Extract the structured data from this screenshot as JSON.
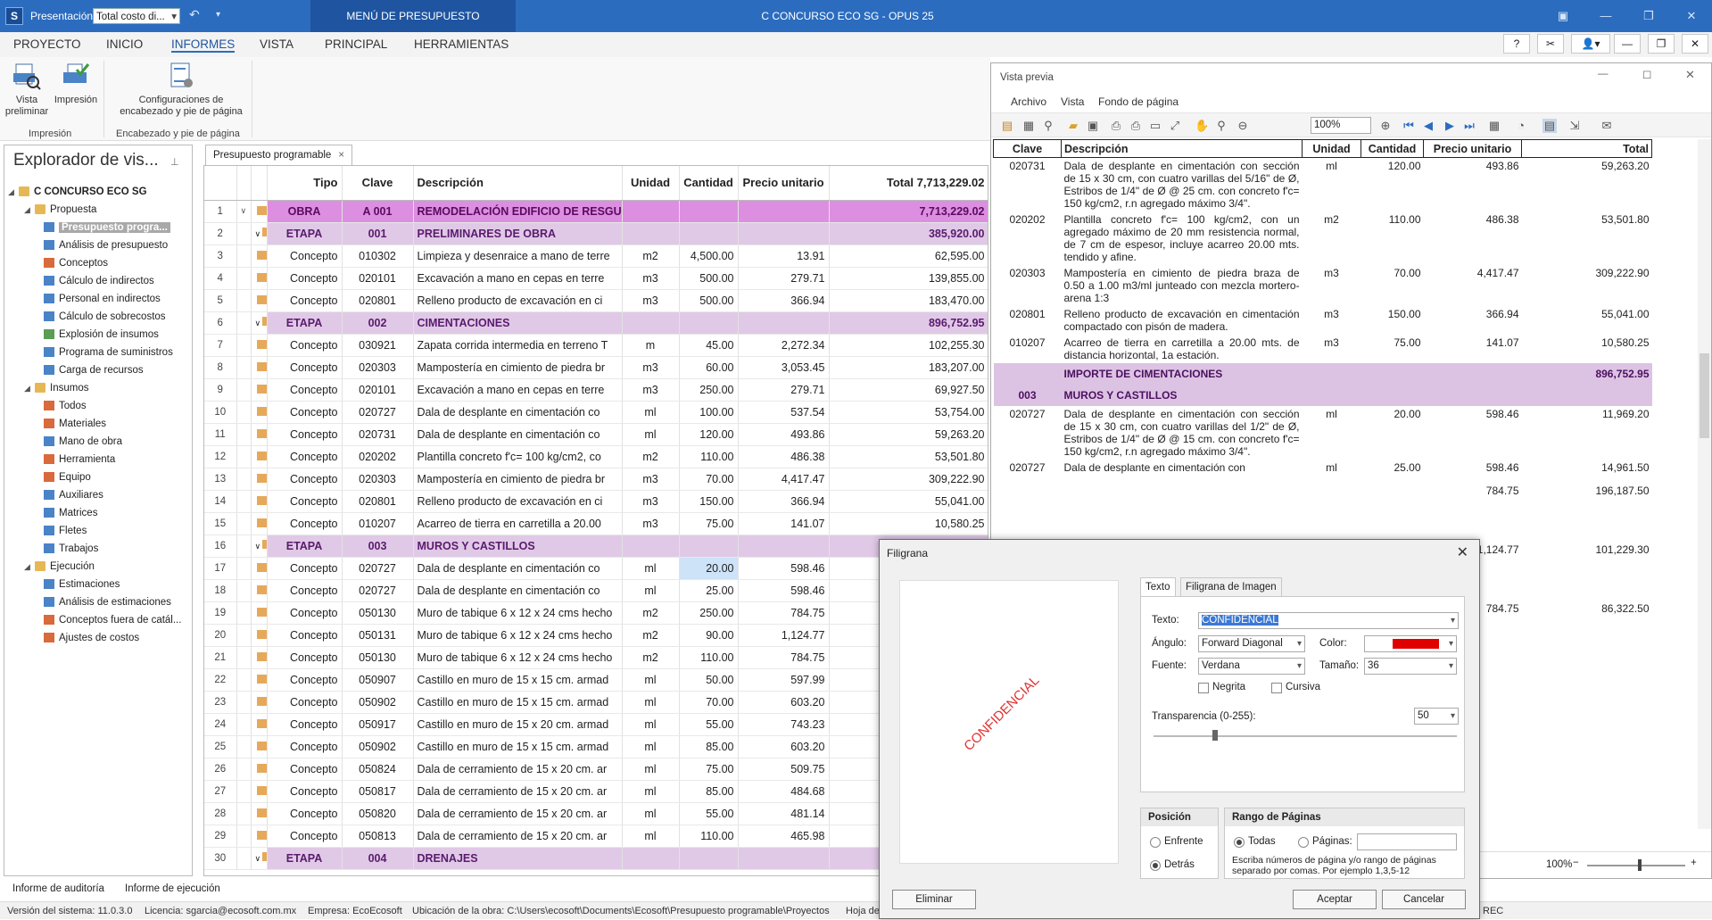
{
  "titlebar": {
    "app_icon": "S",
    "presentation_label": "Presentación:",
    "presentation_value": "Total costo di...",
    "menu_tab": "MENÚ DE PRESUPUESTO",
    "title": "C CONCURSO ECO SG - OPUS 25"
  },
  "menu": {
    "items": [
      "PROYECTO",
      "INICIO",
      "INFORMES",
      "VISTA",
      "PRINCIPAL",
      "HERRAMIENTAS"
    ],
    "active": "INFORMES",
    "help": "?"
  },
  "ribbon": {
    "vista_previa": "Vista\npreliminar",
    "impresion": "Impresión",
    "config": "Configuraciones de\nencabezado y pie de página",
    "group_impresion": "Impresión",
    "group_encabezado": "Encabezado y pie de página"
  },
  "explorer": {
    "title": "Explorador de vis...",
    "root": "C CONCURSO ECO SG",
    "propuesta": "Propuesta",
    "propuesta_items": [
      "Presupuesto progra...",
      "Análisis de presupuesto",
      "Conceptos",
      "Cálculo de indirectos",
      "Personal en indirectos",
      "Cálculo de sobrecostos",
      "Explosión de insumos",
      "Programa de suministros",
      "Carga de recursos"
    ],
    "insumos": "Insumos",
    "insumos_items": [
      "Todos",
      "Materiales",
      "Mano de obra",
      "Herramienta",
      "Equipo",
      "Auxiliares",
      "Matrices",
      "Fletes",
      "Trabajos"
    ],
    "ejecucion": "Ejecución",
    "ejecucion_items": [
      "Estimaciones",
      "Análisis de estimaciones",
      "Conceptos fuera de catál...",
      "Ajustes de costos"
    ]
  },
  "grid": {
    "tab": "Presupuesto programable",
    "headers": {
      "tipo": "Tipo",
      "clave": "Clave",
      "desc": "Descripción",
      "unidad": "Unidad",
      "cantidad": "Cantidad",
      "pu": "Precio unitario",
      "total": "Total 7,713,229.02"
    },
    "rows": [
      [
        "1",
        "OBRA",
        "A 001",
        "REMODELACIÓN EDIFICIO DE RESGUARD",
        "",
        "",
        "",
        "7,713,229.02",
        "obra"
      ],
      [
        "2",
        "ETAPA",
        "001",
        "PRELIMINARES DE OBRA",
        "",
        "",
        "",
        "385,920.00",
        "etapa"
      ],
      [
        "3",
        "Concepto",
        "010302",
        "Limpieza y desenraice a mano de terre",
        "m2",
        "4,500.00",
        "13.91",
        "62,595.00",
        "c"
      ],
      [
        "4",
        "Concepto",
        "020101",
        "Excavación a mano en cepas en terre",
        "m3",
        "500.00",
        "279.71",
        "139,855.00",
        "c"
      ],
      [
        "5",
        "Concepto",
        "020801",
        "Relleno producto de excavación en ci",
        "m3",
        "500.00",
        "366.94",
        "183,470.00",
        "c"
      ],
      [
        "6",
        "ETAPA",
        "002",
        "CIMENTACIONES",
        "",
        "",
        "",
        "896,752.95",
        "etapa"
      ],
      [
        "7",
        "Concepto",
        "030921",
        "Zapata corrida intermedia en terreno T",
        "m",
        "45.00",
        "2,272.34",
        "102,255.30",
        "c"
      ],
      [
        "8",
        "Concepto",
        "020303",
        "Mampostería en cimiento de piedra br",
        "m3",
        "60.00",
        "3,053.45",
        "183,207.00",
        "c"
      ],
      [
        "9",
        "Concepto",
        "020101",
        "Excavación a mano en cepas en terre",
        "m3",
        "250.00",
        "279.71",
        "69,927.50",
        "c"
      ],
      [
        "10",
        "Concepto",
        "020727",
        "Dala de desplante en cimentación co",
        "ml",
        "100.00",
        "537.54",
        "53,754.00",
        "c"
      ],
      [
        "11",
        "Concepto",
        "020731",
        "Dala de desplante en cimentación co",
        "ml",
        "120.00",
        "493.86",
        "59,263.20",
        "c"
      ],
      [
        "12",
        "Concepto",
        "020202",
        "Plantilla concreto f'c= 100 kg/cm2, co",
        "m2",
        "110.00",
        "486.38",
        "53,501.80",
        "c"
      ],
      [
        "13",
        "Concepto",
        "020303",
        "Mampostería en cimiento de piedra br",
        "m3",
        "70.00",
        "4,417.47",
        "309,222.90",
        "c"
      ],
      [
        "14",
        "Concepto",
        "020801",
        "Relleno producto de excavación en ci",
        "m3",
        "150.00",
        "366.94",
        "55,041.00",
        "c"
      ],
      [
        "15",
        "Concepto",
        "010207",
        "Acarreo de tierra en carretilla a 20.00",
        "m3",
        "75.00",
        "141.07",
        "10,580.25",
        "c"
      ],
      [
        "16",
        "ETAPA",
        "003",
        "MUROS Y CASTILLOS",
        "",
        "",
        "",
        "",
        "etapa"
      ],
      [
        "17",
        "Concepto",
        "020727",
        "Dala de desplante en cimentación co",
        "ml",
        "20.00",
        "598.46",
        "",
        "c"
      ],
      [
        "18",
        "Concepto",
        "020727",
        "Dala de desplante en cimentación co",
        "ml",
        "25.00",
        "598.46",
        "",
        "c"
      ],
      [
        "19",
        "Concepto",
        "050130",
        "Muro de tabique 6 x 12 x 24 cms hecho",
        "m2",
        "250.00",
        "784.75",
        "",
        "c"
      ],
      [
        "20",
        "Concepto",
        "050131",
        "Muro de tabique 6 x 12 x 24 cms hecho",
        "m2",
        "90.00",
        "1,124.77",
        "",
        "c"
      ],
      [
        "21",
        "Concepto",
        "050130",
        "Muro de tabique 6 x 12 x 24 cms hecho",
        "m2",
        "110.00",
        "784.75",
        "",
        "c"
      ],
      [
        "22",
        "Concepto",
        "050907",
        "Castillo en muro de 15 x 15 cm. armad",
        "ml",
        "50.00",
        "597.99",
        "",
        "c"
      ],
      [
        "23",
        "Concepto",
        "050902",
        "Castillo en muro de 15 x 15 cm. armad",
        "ml",
        "70.00",
        "603.20",
        "",
        "c"
      ],
      [
        "24",
        "Concepto",
        "050917",
        "Castillo en muro de 15 x 20 cm. armad",
        "ml",
        "55.00",
        "743.23",
        "",
        "c"
      ],
      [
        "25",
        "Concepto",
        "050902",
        "Castillo en muro de 15 x 15 cm. armad",
        "ml",
        "85.00",
        "603.20",
        "",
        "c"
      ],
      [
        "26",
        "Concepto",
        "050824",
        "Dala de cerramiento de 15 x 20 cm. ar",
        "ml",
        "75.00",
        "509.75",
        "",
        "c"
      ],
      [
        "27",
        "Concepto",
        "050817",
        "Dala de cerramiento de 15 x 20 cm. ar",
        "ml",
        "85.00",
        "484.68",
        "",
        "c"
      ],
      [
        "28",
        "Concepto",
        "050820",
        "Dala de cerramiento de 15 x 20 cm. ar",
        "ml",
        "55.00",
        "481.14",
        "",
        "c"
      ],
      [
        "29",
        "Concepto",
        "050813",
        "Dala de cerramiento de 15 x 20 cm. ar",
        "ml",
        "110.00",
        "465.98",
        "",
        "c"
      ],
      [
        "30",
        "ETAPA",
        "004",
        "DRENAJES",
        "",
        "",
        "",
        "",
        "etapa"
      ]
    ]
  },
  "bottom_tabs": [
    "Informe de auditoría",
    "Informe de ejecución"
  ],
  "status": {
    "version": "Versión del sistema: 11.0.3.0",
    "license": "Licencia: sgarcia@ecosoft.com.mx",
    "company": "Empresa: EcoEcosoft",
    "location": "Ubicación de la obra: C:\\Users\\ecosoft\\Documents\\Ecosoft\\Presupuesto programable\\Proyectos",
    "sheet": "Hoja de",
    "rec": "REC"
  },
  "preview": {
    "title": "Vista previa",
    "menu": [
      "Archivo",
      "Vista",
      "Fondo de página"
    ],
    "zoom": "100%",
    "zoom_bottom": "100%",
    "headers": [
      "Clave",
      "Descripción",
      "Unidad",
      "Cantidad",
      "Precio unitario",
      "Total"
    ],
    "rows": [
      {
        "clave": "020731",
        "desc": "Dala de desplante en cimentación con sección de 15 x 30 cm, con cuatro varillas del 5/16\" de Ø, Estribos de 1/4\" de Ø @ 25 cm. con concreto f'c= 150 kg/cm2, r.n agregado máximo 3/4\".",
        "unidad": "ml",
        "cantidad": "120.00",
        "pu": "493.86",
        "total": "59,263.20"
      },
      {
        "clave": "020202",
        "desc": "Plantilla concreto f'c= 100 kg/cm2, con un agregado máximo de 20 mm resistencia normal, de 7 cm de espesor, incluye acarreo 20.00 mts. tendido y afine.",
        "unidad": "m2",
        "cantidad": "110.00",
        "pu": "486.38",
        "total": "53,501.80"
      },
      {
        "clave": "020303",
        "desc": "Mampostería en cimiento de piedra braza de 0.50 a 1.00 m3/ml junteado con mezcla mortero-arena 1:3",
        "unidad": "m3",
        "cantidad": "70.00",
        "pu": "4,417.47",
        "total": "309,222.90"
      },
      {
        "clave": "020801",
        "desc": "Relleno producto de excavación en cimentación compactado con pisón de madera.",
        "unidad": "m3",
        "cantidad": "150.00",
        "pu": "366.94",
        "total": "55,041.00"
      },
      {
        "clave": "010207",
        "desc": "Acarreo de tierra en carretilla a 20.00 mts. de distancia horizontal, 1a estación.",
        "unidad": "m3",
        "cantidad": "75.00",
        "pu": "141.07",
        "total": "10,580.25"
      }
    ],
    "importe_cim": "IMPORTE DE CIMENTACIONES",
    "importe_cim_total": "896,752.95",
    "etapa3_clave": "003",
    "etapa3_name": "MUROS Y CASTILLOS",
    "row_020727": {
      "clave": "020727",
      "desc": "Dala de desplante en cimentación con sección de 15 x 30 cm, con cuatro varillas del 1/2\" de Ø, Estribos de 1/4\" de Ø @ 15 cm. con concreto f'c= 150 kg/cm2, r.n agregado máximo 3/4\".",
      "unidad": "ml",
      "cantidad": "20.00",
      "pu": "598.46",
      "total": "11,969.20"
    },
    "row_020727b": {
      "clave": "020727",
      "desc": "Dala de desplante en cimentación con",
      "unidad": "ml",
      "cantidad": "25.00",
      "pu": "598.46",
      "total": "14,961.50"
    },
    "hidden_vals": [
      {
        "pu": "784.75",
        "total": "196,187.50"
      },
      {
        "pu": "1,124.77",
        "total": "101,229.30"
      },
      {
        "pu": "784.75",
        "total": "86,322.50"
      }
    ]
  },
  "dialog": {
    "title": "Filigrana",
    "watermark_preview": "CONFIDENCIAL",
    "tab_text": "Texto",
    "tab_image": "Filigrana de Imagen",
    "texto_label": "Texto:",
    "texto_value": "CONFIDENCIAL",
    "angulo_label": "Ángulo:",
    "angulo_value": "Forward Diagonal",
    "color_label": "Color:",
    "color_value": "#e00000",
    "fuente_label": "Fuente:",
    "fuente_value": "Verdana",
    "tamano_label": "Tamaño:",
    "tamano_value": "36",
    "negrita": "Negrita",
    "cursiva": "Cursiva",
    "transparencia_label": "Transparencia (0-255):",
    "transparencia_value": "50",
    "posicion_head": "Posición",
    "enfrente": "Enfrente",
    "detras": "Detrás",
    "rango_head": "Rango de Páginas",
    "todas": "Todas",
    "paginas": "Páginas:",
    "rango_hint": "Escriba números de página y/o rango de páginas separado por comas. Por ejemplo 1,3,5-12",
    "eliminar": "Eliminar",
    "aceptar": "Aceptar",
    "cancelar": "Cancelar"
  },
  "colors": {
    "accent": "#2b6cbf",
    "obra": "#dc8fe0",
    "etapa": "#e0c9e6",
    "watermark": "#e23030"
  }
}
